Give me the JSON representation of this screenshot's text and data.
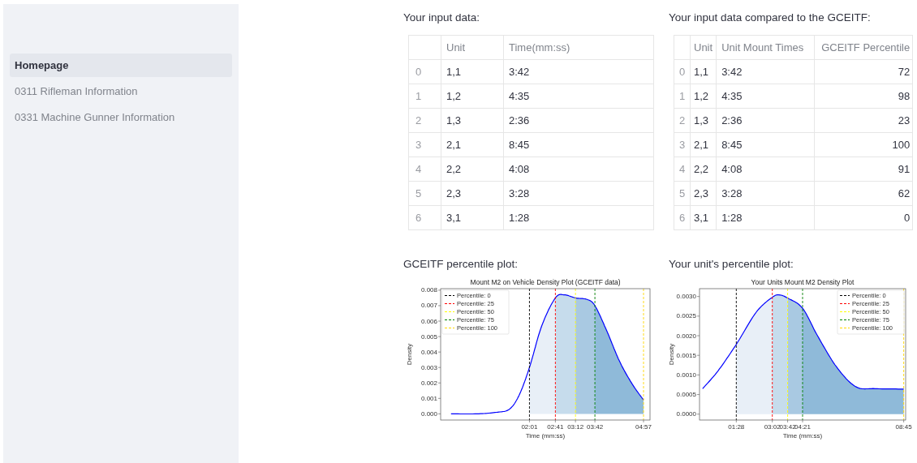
{
  "sidebar": {
    "items": [
      {
        "label": "Homepage",
        "selected": true
      },
      {
        "label": "0311 Rifleman Information",
        "selected": false
      },
      {
        "label": "0331 Machine Gunner Information",
        "selected": false
      }
    ]
  },
  "input_table": {
    "heading": "Your input data:",
    "columns": [
      "",
      "Unit",
      "Time(mm:ss)"
    ],
    "rows": [
      [
        "0",
        "1,1",
        "3:42"
      ],
      [
        "1",
        "1,2",
        "4:35"
      ],
      [
        "2",
        "1,3",
        "2:36"
      ],
      [
        "3",
        "2,1",
        "8:45"
      ],
      [
        "4",
        "2,2",
        "4:08"
      ],
      [
        "5",
        "2,3",
        "3:28"
      ],
      [
        "6",
        "3,1",
        "1:28"
      ]
    ]
  },
  "compare_table": {
    "heading": "Your input data compared to the GCEITF:",
    "columns": [
      "",
      "Unit",
      "Unit Mount Times",
      "GCEITF Percentile"
    ],
    "rows": [
      [
        "0",
        "1,1",
        "3:42",
        "72"
      ],
      [
        "1",
        "1,2",
        "4:35",
        "98"
      ],
      [
        "2",
        "1,3",
        "2:36",
        "23"
      ],
      [
        "3",
        "2,1",
        "8:45",
        "100"
      ],
      [
        "4",
        "2,2",
        "4:08",
        "91"
      ],
      [
        "5",
        "2,3",
        "3:28",
        "62"
      ],
      [
        "6",
        "3,1",
        "1:28",
        "0"
      ]
    ]
  },
  "plots": [
    {
      "heading": "GCEITF percentile plot:",
      "legend": [
        "Percentile: 0",
        "Percentile: 25",
        "Percentile: 50",
        "Percentile: 75",
        "Percentile: 100"
      ],
      "chart_data": {
        "type": "area",
        "title": "Mount M2 on Vehicle Density Plot (GCEITF data)",
        "xlabel": "Time (mm:ss)",
        "ylabel": "Density",
        "x": [
          0,
          40,
          70,
          90,
          105,
          121,
          140,
          161,
          175,
          192,
          210,
          222,
          240,
          260,
          280,
          297
        ],
        "series": [
          {
            "type": "line",
            "color": "#0000ff",
            "values": [
              0,
              0,
              0.0001,
              0.0003,
              0.0012,
              0.003,
              0.0057,
              0.0075,
              0.0077,
              0.0075,
              0.0074,
              0.007,
              0.0054,
              0.0034,
              0.0019,
              0.0009
            ]
          },
          {
            "color": "#e8eff7",
            "values": [
              null,
              null,
              null,
              null,
              null,
              0.003,
              0.0057,
              0.0075,
              null,
              null,
              null,
              null,
              null,
              null,
              null,
              null
            ]
          },
          {
            "color": "#c6dcec",
            "values": [
              null,
              null,
              null,
              null,
              null,
              null,
              null,
              0.0075,
              0.0077,
              0.0075,
              null,
              null,
              null,
              null,
              null,
              null
            ]
          },
          {
            "color": "#a9c9e2",
            "values": [
              null,
              null,
              null,
              null,
              null,
              null,
              null,
              null,
              null,
              0.0075,
              0.0074,
              0.007,
              null,
              null,
              null,
              null
            ]
          },
          {
            "color": "#8fbad9",
            "values": [
              null,
              null,
              null,
              null,
              null,
              null,
              null,
              null,
              null,
              null,
              null,
              0.007,
              0.0054,
              0.0034,
              0.0019,
              0.0009
            ]
          }
        ],
        "xlim": [
          -16,
          307
        ],
        "ylim": [
          -0.0004,
          0.0081
        ],
        "xticks": [
          {
            "value": 121,
            "label": "02:01"
          },
          {
            "value": 161,
            "label": "02:41"
          },
          {
            "value": 192,
            "label": "03:12"
          },
          {
            "value": 222,
            "label": "03:42"
          },
          {
            "value": 297,
            "label": "04:57"
          }
        ],
        "yticks": [
          {
            "value": 0,
            "label": "0.000"
          },
          {
            "value": 0.001,
            "label": "0.001"
          },
          {
            "value": 0.002,
            "label": "0.002"
          },
          {
            "value": 0.003,
            "label": "0.003"
          },
          {
            "value": 0.004,
            "label": "0.004"
          },
          {
            "value": 0.005,
            "label": "0.005"
          },
          {
            "value": 0.006,
            "label": "0.006"
          },
          {
            "value": 0.007,
            "label": "0.007"
          },
          {
            "value": 0.008,
            "label": "0.008"
          }
        ],
        "ref_lines": [
          {
            "axis": "x",
            "value": 121,
            "color": "#000000"
          },
          {
            "axis": "x",
            "value": 161,
            "color": "#ff0000"
          },
          {
            "axis": "x",
            "value": 192,
            "color": "#ffff00"
          },
          {
            "axis": "x",
            "value": 222,
            "color": "#008000"
          },
          {
            "axis": "x",
            "value": 297,
            "color": "#ffd700"
          }
        ]
      }
    },
    {
      "heading": "Your unit's percentile plot:",
      "legend": [
        "Percentile: 0",
        "Percentile: 25",
        "Percentile: 50",
        "Percentile: 75",
        "Percentile: 100"
      ],
      "chart_data": {
        "type": "area",
        "title": "Your Units Mount M2 Density Plot",
        "xlabel": "Time (mm:ss)",
        "ylabel": "Density",
        "x": [
          0,
          40,
          88,
          140,
          182,
          200,
          222,
          261,
          300,
          350,
          400,
          450,
          525
        ],
        "series": [
          {
            "type": "line",
            "color": "#0000ff",
            "values": [
              0.00065,
              0.0011,
              0.00178,
              0.0026,
              0.00298,
              0.00304,
              0.00296,
              0.0027,
              0.002,
              0.0012,
              0.0007,
              0.00065,
              0.00064
            ]
          },
          {
            "color": "#e8eff7",
            "values": [
              null,
              null,
              0.00178,
              0.0026,
              0.00298,
              null,
              null,
              null,
              null,
              null,
              null,
              null,
              null
            ]
          },
          {
            "color": "#c6dcec",
            "values": [
              null,
              null,
              null,
              null,
              0.00298,
              0.00304,
              0.00296,
              null,
              null,
              null,
              null,
              null,
              null
            ]
          },
          {
            "color": "#a9c9e2",
            "values": [
              null,
              null,
              null,
              null,
              null,
              null,
              0.00296,
              0.0027,
              null,
              null,
              null,
              null,
              null
            ]
          },
          {
            "color": "#8fbad9",
            "values": [
              null,
              null,
              null,
              null,
              null,
              null,
              null,
              0.0027,
              0.002,
              0.0012,
              0.0007,
              0.00065,
              0.00064
            ]
          }
        ],
        "xlim": [
          -8,
          530
        ],
        "ylim": [
          -0.00015,
          0.0032
        ],
        "xticks": [
          {
            "value": 88,
            "label": "01:28"
          },
          {
            "value": 182,
            "label": "03:02"
          },
          {
            "value": 222,
            "label": "03:42"
          },
          {
            "value": 261,
            "label": "04:21"
          },
          {
            "value": 525,
            "label": "08:45"
          }
        ],
        "yticks": [
          {
            "value": 0,
            "label": "0.0000"
          },
          {
            "value": 0.0005,
            "label": "0.0005"
          },
          {
            "value": 0.001,
            "label": "0.0010"
          },
          {
            "value": 0.0015,
            "label": "0.0015"
          },
          {
            "value": 0.002,
            "label": "0.0020"
          },
          {
            "value": 0.0025,
            "label": "0.0025"
          },
          {
            "value": 0.003,
            "label": "0.0030"
          }
        ],
        "ref_lines": [
          {
            "axis": "x",
            "value": 88,
            "color": "#000000"
          },
          {
            "axis": "x",
            "value": 182,
            "color": "#ff0000"
          },
          {
            "axis": "x",
            "value": 222,
            "color": "#ffff00"
          },
          {
            "axis": "x",
            "value": 261,
            "color": "#008000"
          },
          {
            "axis": "x",
            "value": 525,
            "color": "#ffd700"
          }
        ]
      }
    }
  ]
}
